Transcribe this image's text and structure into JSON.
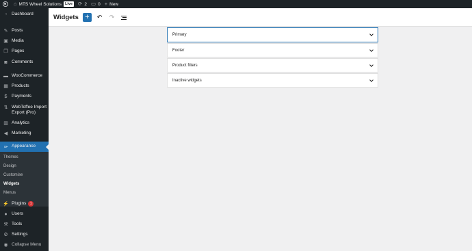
{
  "admin_bar": {
    "site_name": "MTS Wheel Solutions",
    "live_label": "Live",
    "updates_count": "2",
    "comments_count": "0",
    "new_label": "New"
  },
  "sidebar": {
    "items": [
      {
        "label": "Dashboard",
        "icon": "dashboard-icon"
      },
      {
        "label": "Posts",
        "icon": "pin-icon"
      },
      {
        "label": "Media",
        "icon": "media-icon"
      },
      {
        "label": "Pages",
        "icon": "pages-icon"
      },
      {
        "label": "Comments",
        "icon": "comment-icon"
      },
      {
        "label": "WooCommerce",
        "icon": "woocommerce-icon"
      },
      {
        "label": "Products",
        "icon": "products-icon"
      },
      {
        "label": "Payments",
        "icon": "payments-icon"
      },
      {
        "label": "WebToffee Import Export (Pro)",
        "icon": "import-export-icon"
      },
      {
        "label": "Analytics",
        "icon": "analytics-icon"
      },
      {
        "label": "Marketing",
        "icon": "megaphone-icon"
      },
      {
        "label": "Appearance",
        "icon": "paintbrush-icon"
      },
      {
        "label": "Plugins",
        "icon": "plugin-icon",
        "badge": "1"
      },
      {
        "label": "Users",
        "icon": "users-icon"
      },
      {
        "label": "Tools",
        "icon": "wrench-icon"
      },
      {
        "label": "Settings",
        "icon": "settings-icon"
      },
      {
        "label": "Collapse Menu",
        "icon": "collapse-icon"
      }
    ],
    "appearance_submenu": [
      "Themes",
      "Design",
      "Customise",
      "Widgets",
      "Menus"
    ]
  },
  "header": {
    "title": "Widgets",
    "add_block_symbol": "+",
    "undo_symbol": "↶",
    "redo_symbol": "↷"
  },
  "widget_areas": [
    "Primary",
    "Footer",
    "Product filters",
    "Inactive widgets"
  ],
  "colors": {
    "accent": "#2271b1",
    "sidebar_bg": "#1d2327",
    "submenu_bg": "#2c3338",
    "badge": "#d63638",
    "page_bg": "#f0f0f1"
  }
}
